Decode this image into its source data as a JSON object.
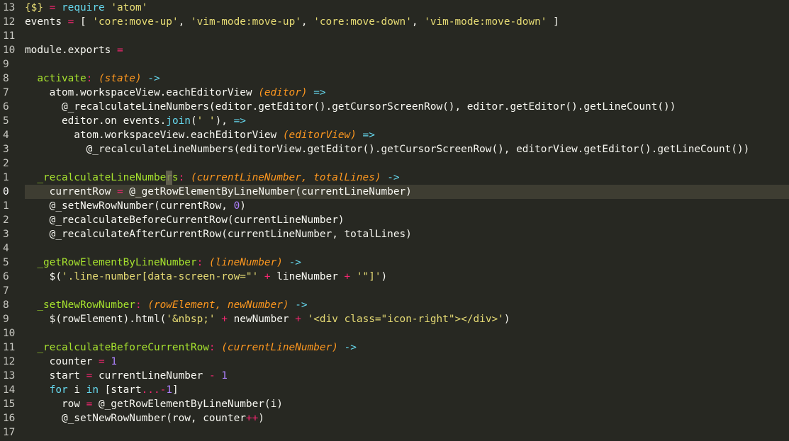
{
  "colors": {
    "background": "#272822",
    "current_line": "#3e3d32",
    "text": "#f8f8f2",
    "keyword": "#66d9ef",
    "operator": "#f92672",
    "string": "#e6db74",
    "number": "#ae81ff",
    "parameter": "#fd971f",
    "function": "#a6e22e"
  },
  "cursor": {
    "line": 12,
    "column": 23
  },
  "lines": [
    {
      "num": "13",
      "tokens": [
        [
          "{$}",
          "str"
        ],
        [
          " ",
          "text"
        ],
        [
          "=",
          "op"
        ],
        [
          " ",
          "text"
        ],
        [
          "require",
          "key"
        ],
        [
          " ",
          "text"
        ],
        [
          "'atom'",
          "str"
        ]
      ]
    },
    {
      "num": "12",
      "tokens": [
        [
          "events",
          "text"
        ],
        [
          " ",
          "text"
        ],
        [
          "=",
          "op"
        ],
        [
          " [ ",
          "text"
        ],
        [
          "'core:move-up'",
          "str"
        ],
        [
          ", ",
          "text"
        ],
        [
          "'vim-mode:move-up'",
          "str"
        ],
        [
          ", ",
          "text"
        ],
        [
          "'core:move-down'",
          "str"
        ],
        [
          ", ",
          "text"
        ],
        [
          "'vim-mode:move-down'",
          "str"
        ],
        [
          " ]",
          "text"
        ]
      ]
    },
    {
      "num": "11",
      "tokens": []
    },
    {
      "num": "10",
      "tokens": [
        [
          "module.exports",
          "text"
        ],
        [
          " ",
          "text"
        ],
        [
          "=",
          "op"
        ]
      ]
    },
    {
      "num": "9",
      "tokens": []
    },
    {
      "num": "8",
      "tokens": [
        [
          "  ",
          "text"
        ],
        [
          "activate",
          "fn"
        ],
        [
          ": ",
          "op"
        ],
        [
          "(state)",
          "param"
        ],
        [
          " ",
          "text"
        ],
        [
          "->",
          "arrow"
        ]
      ]
    },
    {
      "num": "7",
      "tokens": [
        [
          "    atom.workspaceView.eachEditorView ",
          "text"
        ],
        [
          "(editor)",
          "param"
        ],
        [
          " ",
          "text"
        ],
        [
          "=>",
          "arrow"
        ]
      ]
    },
    {
      "num": "6",
      "tokens": [
        [
          "      @_recalculateLineNumbers(editor.getEditor().getCursorScreenRow(), editor.getEditor().getLineCount())",
          "text"
        ]
      ]
    },
    {
      "num": "5",
      "tokens": [
        [
          "      editor.on events.",
          "text"
        ],
        [
          "join",
          "key"
        ],
        [
          "(",
          "text"
        ],
        [
          "' '",
          "str"
        ],
        [
          "), ",
          "text"
        ],
        [
          "=>",
          "arrow"
        ]
      ]
    },
    {
      "num": "4",
      "tokens": [
        [
          "        atom.workspaceView.eachEditorView ",
          "text"
        ],
        [
          "(editorView)",
          "param"
        ],
        [
          " ",
          "text"
        ],
        [
          "=>",
          "arrow"
        ]
      ]
    },
    {
      "num": "3",
      "tokens": [
        [
          "          @_recalculateLineNumbers(editorView.getEditor().getCursorScreenRow(), editorView.getEditor().getLineCount())",
          "text"
        ]
      ]
    },
    {
      "num": "2",
      "tokens": []
    },
    {
      "num": "1",
      "tokens": [
        [
          "  ",
          "text"
        ],
        [
          "_recalculateLineNumbers",
          "fn"
        ],
        [
          ": ",
          "op"
        ],
        [
          "(currentLineNumber, totalLines)",
          "param"
        ],
        [
          " ",
          "text"
        ],
        [
          "->",
          "arrow"
        ]
      ]
    },
    {
      "num": "0",
      "current": true,
      "tokens": [
        [
          "    currentRow ",
          "text"
        ],
        [
          "=",
          "op"
        ],
        [
          " @_getRowElementByLineNumber(currentLineNumber)",
          "text"
        ]
      ]
    },
    {
      "num": "1",
      "tokens": [
        [
          "    @_setNewRowNumber(currentRow, ",
          "text"
        ],
        [
          "0",
          "num"
        ],
        [
          ")",
          "text"
        ]
      ]
    },
    {
      "num": "2",
      "tokens": [
        [
          "    @_recalculateBeforeCurrentRow(currentLineNumber)",
          "text"
        ]
      ]
    },
    {
      "num": "3",
      "tokens": [
        [
          "    @_recalculateAfterCurrentRow(currentLineNumber, totalLines)",
          "text"
        ]
      ]
    },
    {
      "num": "4",
      "tokens": []
    },
    {
      "num": "5",
      "tokens": [
        [
          "  ",
          "text"
        ],
        [
          "_getRowElementByLineNumber",
          "fn"
        ],
        [
          ": ",
          "op"
        ],
        [
          "(lineNumber)",
          "param"
        ],
        [
          " ",
          "text"
        ],
        [
          "->",
          "arrow"
        ]
      ]
    },
    {
      "num": "6",
      "tokens": [
        [
          "    $(",
          "text"
        ],
        [
          "'.line-number[data-screen-row=\"'",
          "str"
        ],
        [
          " ",
          "text"
        ],
        [
          "+",
          "op"
        ],
        [
          " lineNumber ",
          "text"
        ],
        [
          "+",
          "op"
        ],
        [
          " ",
          "text"
        ],
        [
          "'\"]'",
          "str"
        ],
        [
          ")",
          "text"
        ]
      ]
    },
    {
      "num": "7",
      "tokens": []
    },
    {
      "num": "8",
      "tokens": [
        [
          "  ",
          "text"
        ],
        [
          "_setNewRowNumber",
          "fn"
        ],
        [
          ": ",
          "op"
        ],
        [
          "(rowElement, newNumber)",
          "param"
        ],
        [
          " ",
          "text"
        ],
        [
          "->",
          "arrow"
        ]
      ]
    },
    {
      "num": "9",
      "tokens": [
        [
          "    $(rowElement).html(",
          "text"
        ],
        [
          "'&nbsp;'",
          "str"
        ],
        [
          " ",
          "text"
        ],
        [
          "+",
          "op"
        ],
        [
          " newNumber ",
          "text"
        ],
        [
          "+",
          "op"
        ],
        [
          " ",
          "text"
        ],
        [
          "'<div class=\"icon-right\"></div>'",
          "str"
        ],
        [
          ")",
          "text"
        ]
      ]
    },
    {
      "num": "10",
      "tokens": []
    },
    {
      "num": "11",
      "tokens": [
        [
          "  ",
          "text"
        ],
        [
          "_recalculateBeforeCurrentRow",
          "fn"
        ],
        [
          ": ",
          "op"
        ],
        [
          "(currentLineNumber)",
          "param"
        ],
        [
          " ",
          "text"
        ],
        [
          "->",
          "arrow"
        ]
      ]
    },
    {
      "num": "12",
      "tokens": [
        [
          "    counter ",
          "text"
        ],
        [
          "=",
          "op"
        ],
        [
          " ",
          "text"
        ],
        [
          "1",
          "num"
        ]
      ]
    },
    {
      "num": "13",
      "tokens": [
        [
          "    start ",
          "text"
        ],
        [
          "=",
          "op"
        ],
        [
          " currentLineNumber ",
          "text"
        ],
        [
          "-",
          "op"
        ],
        [
          " ",
          "text"
        ],
        [
          "1",
          "num"
        ]
      ]
    },
    {
      "num": "14",
      "tokens": [
        [
          "    ",
          "text"
        ],
        [
          "for",
          "key"
        ],
        [
          " i ",
          "text"
        ],
        [
          "in",
          "key"
        ],
        [
          " [start",
          "text"
        ],
        [
          "...",
          "op"
        ],
        [
          "-",
          "op"
        ],
        [
          "1",
          "num"
        ],
        [
          "]",
          "text"
        ]
      ]
    },
    {
      "num": "15",
      "tokens": [
        [
          "      row ",
          "text"
        ],
        [
          "=",
          "op"
        ],
        [
          " @_getRowElementByLineNumber(i)",
          "text"
        ]
      ]
    },
    {
      "num": "16",
      "tokens": [
        [
          "      @_setNewRowNumber(row, counter",
          "text"
        ],
        [
          "++",
          "op"
        ],
        [
          ")",
          "text"
        ]
      ]
    },
    {
      "num": "17",
      "tokens": []
    }
  ]
}
